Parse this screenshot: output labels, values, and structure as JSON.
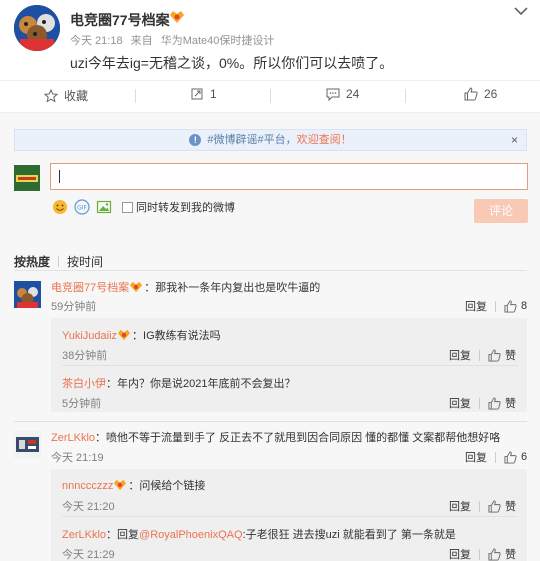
{
  "post": {
    "author": "电竞圈77号档案",
    "time": "今天 21:18",
    "source_prefix": "来自",
    "source": "华为Mate40保时捷设计",
    "text": "uzi今年去ig=无稽之谈，0%。所以你们可以去喷了。"
  },
  "actions": {
    "favorite": "收藏",
    "repost_count": "1",
    "comment_count": "24",
    "like_count": "26"
  },
  "notice": {
    "hashtag": "#微博辟谣#",
    "text": "平台，",
    "link": "欢迎查阅！",
    "close": "×"
  },
  "composer": {
    "repost_label": "同时转发到我的微博",
    "submit_label": "评论"
  },
  "sort": {
    "hot": "按热度",
    "time": "按时间"
  },
  "comments": [
    {
      "name": "电竞圈77号档案",
      "text": "：那我补一条年内复出也是吹牛逼的",
      "time": "59分钟前",
      "reply": "回复",
      "likes": "8",
      "replies": [
        {
          "name": "YukiJudaiiz",
          "text": "：IG教练有说法吗",
          "time": "38分钟前",
          "reply": "回复",
          "likes": "赞"
        },
        {
          "name": "茶白小伊",
          "text": "：年内？你是说2021年底前不会复出？",
          "time": "5分钟前",
          "reply": "回复",
          "likes": "赞"
        }
      ]
    },
    {
      "name": "ZerLKklo",
      "text": "：喷他不等于流量到手了 反正去不了就甩到因合同原因 懂的都懂 文案都帮他想好咯",
      "time": "今天 21:19",
      "reply": "回复",
      "likes": "6",
      "replies": [
        {
          "name": "nnnccczzz",
          "text": "：问候给个链接",
          "time": "今天 21:20",
          "reply": "回复",
          "likes": "赞"
        },
        {
          "name": "ZerLKklo",
          "reply_prefix": "：回复",
          "mention": "@RoyalPhoenixQAQ",
          "text": ":子老很狂 进去搜uzi 就能看到了 第一条就是",
          "time": "今天 21:29",
          "reply": "回复",
          "likes": "赞"
        }
      ]
    }
  ],
  "colors": {
    "accent": "#eb7350",
    "submit_disabled": "#f8c9b4",
    "notice_bg": "#eaf1fb",
    "area_bg": "#f7f7f7"
  }
}
